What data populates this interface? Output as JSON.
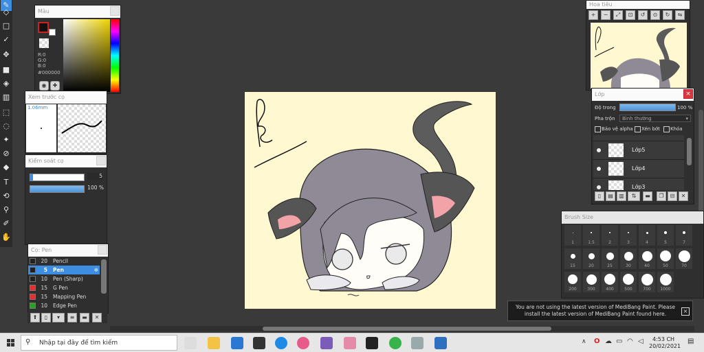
{
  "panels": {
    "color": {
      "title": "Màu",
      "r_label": "R:0",
      "g_label": "G:0",
      "b_label": "B:0",
      "hex": "#000000"
    },
    "brush_preview": {
      "title": "Xem trước cọ",
      "size": "1.06mm"
    },
    "brush_control": {
      "title": "Kiểm soát cọ",
      "size_value": "5",
      "opacity_value": "100 %"
    },
    "brush_list": {
      "title": "Cọ: Pen",
      "items": [
        {
          "size": "20",
          "name": "Pencil",
          "color": "#222222"
        },
        {
          "size": "5",
          "name": "Pen",
          "color": "#222222"
        },
        {
          "size": "10",
          "name": "Pen (Sharp)",
          "color": "#222222"
        },
        {
          "size": "15",
          "name": "G Pen",
          "color": "#e03030"
        },
        {
          "size": "15",
          "name": "Mapping Pen",
          "color": "#e03030"
        },
        {
          "size": "10",
          "name": "Edge Pen",
          "color": "#28a028"
        }
      ]
    },
    "navigator": {
      "title": "Hoa tiêu"
    },
    "layers": {
      "title": "Lớp",
      "opacity_label": "Độ trong",
      "opacity_value": "100 %",
      "blend_label": "Pha trộn",
      "blend_value": "Bình thường",
      "protect_alpha": "Bảo vệ alpha",
      "clipping": "Xén bớt",
      "lock": "Khóa",
      "items": [
        {
          "name": "Lớp5"
        },
        {
          "name": "Lớp4"
        },
        {
          "name": "Lớp3"
        }
      ]
    },
    "brush_size": {
      "title": "Brush Size",
      "row1": [
        "1",
        "1.5",
        "2",
        "3",
        "4",
        "5",
        "7"
      ],
      "row2": [
        "15",
        "20",
        "25",
        "30",
        "40",
        "50",
        "70"
      ],
      "row3": [
        "200",
        "300",
        "400",
        "500",
        "700",
        "1000"
      ]
    }
  },
  "notification": {
    "line1": "You are not using the latest version of MediBang Paint. Please install the latest version of MediBang Paint found here."
  },
  "taskbar": {
    "search_placeholder": "Nhập tại đây để tìm kiếm",
    "time": "4:53 CH",
    "date": "20/02/2021"
  },
  "colors": {
    "canvas_bg": "#fff8d0",
    "accent": "#3d8ee0",
    "workspace": "#3a3a3a"
  }
}
